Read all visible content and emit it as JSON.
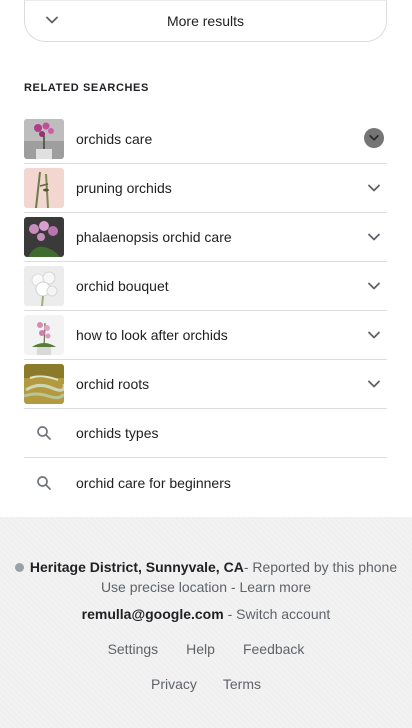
{
  "more_results": {
    "label": "More results",
    "icon": "chevron-down-icon"
  },
  "related": {
    "title": "RELATED SEARCHES",
    "items": [
      {
        "label": "orchids care",
        "thumb": "orchid-photo",
        "chevron": "chevron-down-icon"
      },
      {
        "label": "pruning orchids",
        "thumb": "orchid-photo",
        "chevron": "chevron-down-icon"
      },
      {
        "label": "phalaenopsis orchid care",
        "thumb": "orchid-photo",
        "chevron": "chevron-down-icon"
      },
      {
        "label": "orchid bouquet",
        "thumb": "orchid-photo",
        "chevron": "chevron-down-icon"
      },
      {
        "label": "how to look after orchids",
        "thumb": "orchid-photo",
        "chevron": "chevron-down-icon"
      },
      {
        "label": "orchid roots",
        "thumb": "orchid-photo",
        "chevron": "chevron-down-icon"
      },
      {
        "label": "orchids types",
        "icon": "search-icon"
      },
      {
        "label": "orchid care for beginners",
        "icon": "search-icon"
      }
    ]
  },
  "footer": {
    "location": "Heritage District, Sunnyvale, CA",
    "reported": " - Reported by this phone",
    "precise": "Use precise location",
    "sep": " - ",
    "learn_more": "Learn more",
    "email": "remulla@google.com",
    "switch_sep": " - ",
    "switch_account": "Switch account",
    "links_row1": [
      "Settings",
      "Help",
      "Feedback"
    ],
    "links_row2": [
      "Privacy",
      "Terms"
    ]
  },
  "colors": {
    "text": "#202124",
    "secondary": "#5f6368",
    "divider": "#dadce0",
    "footer_bg": "#f2f2f2"
  }
}
